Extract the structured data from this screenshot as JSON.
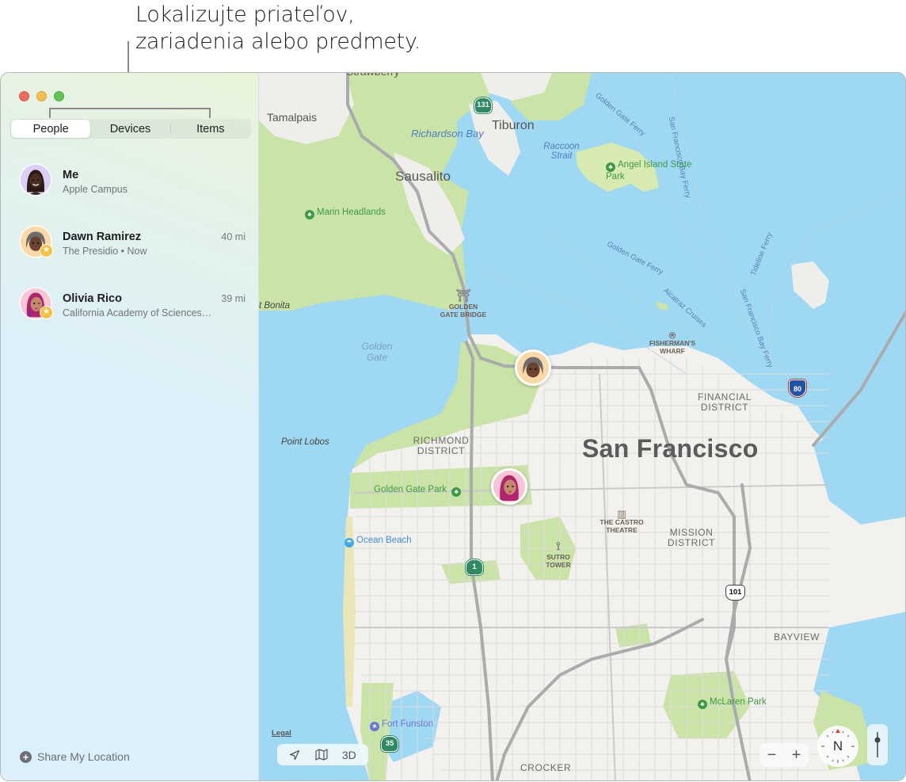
{
  "callout": {
    "line1": "Lokalizujte priateľov,",
    "line2": "zariadenia alebo predmety."
  },
  "window": {
    "traffic_lights": [
      "close",
      "minimize",
      "maximize"
    ]
  },
  "tabs": [
    {
      "label": "People",
      "active": true
    },
    {
      "label": "Devices",
      "active": false
    },
    {
      "label": "Items",
      "active": false
    }
  ],
  "people": [
    {
      "name": "Me",
      "subtitle": "Apple Campus",
      "distance": "",
      "favorite": false,
      "avatar": "memoji-me"
    },
    {
      "name": "Dawn Ramirez",
      "subtitle": "The Presidio • Now",
      "distance": "40 mi",
      "favorite": true,
      "avatar": "memoji-dawn"
    },
    {
      "name": "Olivia Rico",
      "subtitle": "California Academy of Sciences…",
      "distance": "39 mi",
      "favorite": true,
      "avatar": "memoji-olivia"
    }
  ],
  "share_location": {
    "label": "Share My Location",
    "icon": "plus-circle-icon"
  },
  "map": {
    "labels": {
      "strawberry": "Strawberry",
      "tamalpais": "Tamalpais",
      "tiburon": "Tiburon",
      "richardson_bay": "Richardson Bay",
      "raccoon_strait": "Raccoon Strait",
      "angel_island": "Angel Island State Park",
      "sausalito": "Sausalito",
      "marin_headlands": "Marin Headlands",
      "point_bonita": "t Bonita",
      "golden_gate_bridge": "GOLDEN GATE BRIDGE",
      "golden_gate": "Golden Gate",
      "fishermans_wharf": "FISHERMAN'S WHARF",
      "financial_district": "FINANCIAL DISTRICT",
      "point_lobos": "Point Lobos",
      "richmond_district": "RICHMOND DISTRICT",
      "san_francisco": "San Francisco",
      "golden_gate_park": "Golden Gate Park",
      "castro_theatre": "THE CASTRO THEATRE",
      "mission_district": "MISSION DISTRICT",
      "ocean_beach": "Ocean Beach",
      "sutro_tower": "SUTRO TOWER",
      "bayview": "BAYVIEW",
      "mclaren_park": "McLaren Park",
      "fort_funston": "Fort Funston",
      "crocker": "CROCKER",
      "golden_gate_ferry_1": "Golden Gate Ferry",
      "golden_gate_ferry_2": "Golden Gate Ferry",
      "sf_bay_ferry_1": "San Francisco Bay Ferry",
      "sf_bay_ferry_2": "San Francisco Bay Ferry",
      "tideline_ferry": "Tideline Ferry",
      "alcatraz_cruises": "Alcatraz Cruises"
    },
    "route_shields": {
      "ca131": "131",
      "ca1": "1",
      "ca35": "35",
      "us101": "101",
      "i80": "80"
    },
    "legal": "Legal",
    "controls": {
      "location_icon": "location-arrow-icon",
      "map_icon": "map-icon",
      "three_d": "3D",
      "zoom_out": "−",
      "zoom_in": "+",
      "compass": "N"
    }
  },
  "colors": {
    "water": "#9ed8f3",
    "land": "#f2f1ed",
    "park": "#c8e3a4",
    "traffic_close": "#ee6a5e",
    "traffic_min": "#f5be4f",
    "traffic_max": "#61c554",
    "favorite_badge": "#f6c244"
  }
}
